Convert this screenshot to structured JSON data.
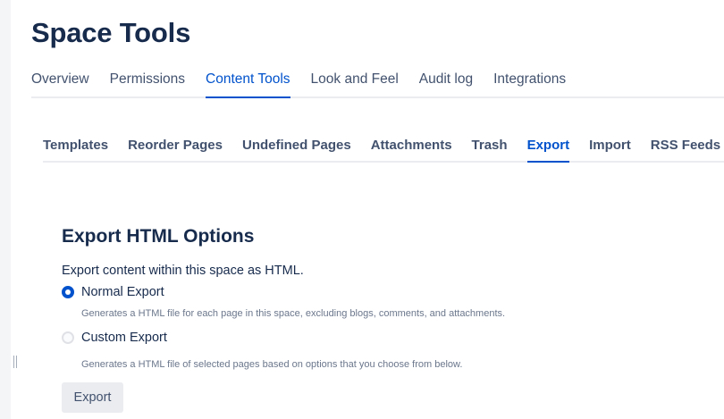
{
  "page_title": "Space Tools",
  "main_tabs": [
    {
      "label": "Overview",
      "active": false
    },
    {
      "label": "Permissions",
      "active": false
    },
    {
      "label": "Content Tools",
      "active": true
    },
    {
      "label": "Look and Feel",
      "active": false
    },
    {
      "label": "Audit log",
      "active": false
    },
    {
      "label": "Integrations",
      "active": false
    }
  ],
  "sub_tabs": [
    {
      "label": "Templates",
      "active": false
    },
    {
      "label": "Reorder Pages",
      "active": false
    },
    {
      "label": "Undefined Pages",
      "active": false
    },
    {
      "label": "Attachments",
      "active": false
    },
    {
      "label": "Trash",
      "active": false
    },
    {
      "label": "Export",
      "active": true
    },
    {
      "label": "Import",
      "active": false
    },
    {
      "label": "RSS Feeds",
      "active": false
    }
  ],
  "export_section": {
    "heading": "Export HTML Options",
    "description": "Export content within this space as HTML.",
    "options": [
      {
        "label": "Normal Export",
        "help": "Generates a HTML file for each page in this space, excluding blogs, comments, and attachments.",
        "selected": true
      },
      {
        "label": "Custom Export",
        "help": "Generates a HTML file of selected pages based on options that you choose from below.",
        "selected": false
      }
    ],
    "button_label": "Export"
  },
  "colors": {
    "accent": "#0052cc",
    "text": "#172b4d",
    "subtle_text": "#42526e",
    "help_text": "#6b778c"
  }
}
